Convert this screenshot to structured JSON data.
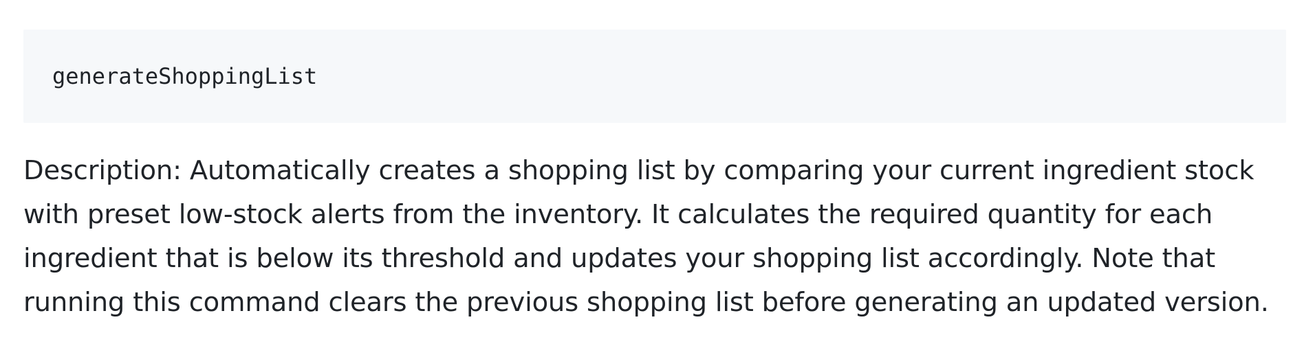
{
  "code": {
    "text": "generateShoppingList"
  },
  "description": {
    "text": "Description: Automatically creates a shopping list by comparing your current ingredient stock with preset low-stock alerts from the inventory. It calculates the required quantity for each ingredient that is below its threshold and updates your shopping list accordingly. Note that running this command clears the previous shopping list before generating an updated version."
  }
}
